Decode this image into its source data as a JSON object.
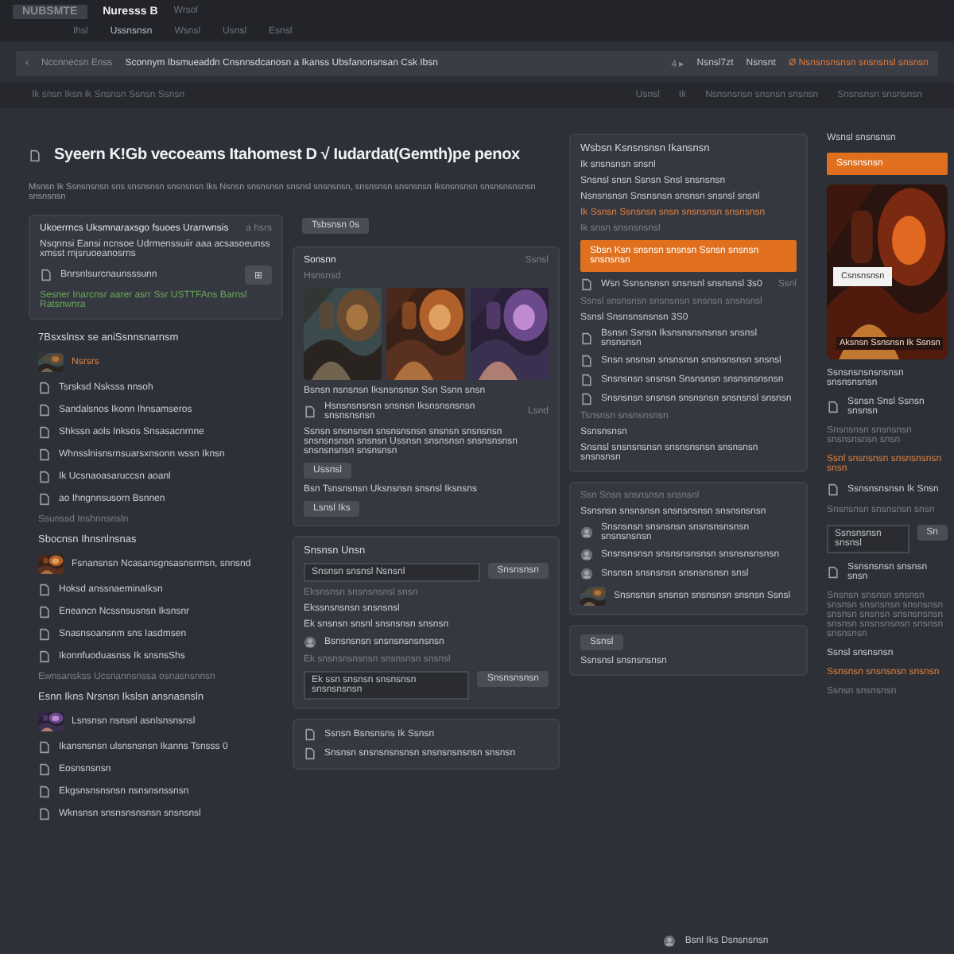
{
  "app": {
    "logo": "NUBSMTE",
    "title": "Nuresss B",
    "badge": "Wrsol"
  },
  "nav": [
    {
      "label": "Ihsl",
      "selected": false
    },
    {
      "label": "Ussnsnsn",
      "selected": true
    },
    {
      "label": "Wsnsl",
      "selected": false
    },
    {
      "label": "Usnsl",
      "selected": false
    },
    {
      "label": "Esnsl",
      "selected": false
    }
  ],
  "address_bar": {
    "back": "‹",
    "label": "Nccnnecsn Enss",
    "url": "Sconnym Ibsmueaddn Cnsnnsdcanosn a Ikanss Ubsfanonsnsan Csk Ibsn",
    "pager": "4 ▸",
    "buttons": [
      "Nsnsl7zt",
      "Nsnsnt"
    ],
    "link": "Ø Nsnsnsnsnsn snsnsnsl snsnsn"
  },
  "sub_bar": {
    "left": "Ik snsn Iksn ik  Snsnsn Ssnsn Ssnsn",
    "right": [
      "Usnsl",
      "Ik",
      "Nsnsnsnsn snsnsn snsnsn",
      "Snsnsnsn snsnsnsn"
    ]
  },
  "heading": {
    "title": "Syeern K!Gb vecoeams Itahomest D √ Iudardat(Gemth)pe penox",
    "subtitle": "Msnsn Ik Ssnsnsnsn sns snsnsnsn snsnsnsn Iks Nsnsn snsnsnsn snsnsl snsnsnsn, snsnsnsn snsnsnsn Iksnsnsnsn snsnsnsnsnsn snsnsnsn"
  },
  "columns": [
    [
      {
        "kind": "card",
        "rows": [
          {
            "kind": "header",
            "text": "Ukoerrncs Uksmnaraxsgo fsuoes Urarrwnsis",
            "aside": "a hsrs"
          },
          {
            "kind": "text",
            "text": "Nsqnnsi Eansi ncnsoe Udrmenssuiir aaa acsasoeunss xmsst rnjsruoeanosrns"
          },
          {
            "kind": "item",
            "text": "Bnrsnlsurcnaunsssunn",
            "button": "⊞"
          },
          {
            "kind": "green",
            "text": "Sesner Inarcnsr aarer asrr Ssr USTTFAns Barnsl Ratsnwnra"
          }
        ]
      },
      {
        "kind": "plain",
        "rows": [
          {
            "kind": "heading",
            "text": "7Bsxslnsx se aniSsnnsnarnsm"
          },
          {
            "kind": "media",
            "text": "Nsrsrs",
            "accent": true
          },
          {
            "kind": "item",
            "text": "Tsrsksd Nsksss nnsoh"
          },
          {
            "kind": "item",
            "text": "Sandalsnos Ikonn Ihnsamseros"
          },
          {
            "kind": "item",
            "text": "Shkssn aols Inksos Snsasacnrnne"
          },
          {
            "kind": "item",
            "text": "Whnsslnisnsrnsuarsxnsonn wssn Iknsn"
          },
          {
            "kind": "item",
            "text": "Ik Ucsnaoasaruccsn aoanl"
          },
          {
            "kind": "item",
            "text": "ao Ihngnnsusorn Bsnnen"
          },
          {
            "kind": "muted",
            "text": "Ssunssd Inshnnsnsln"
          },
          {
            "kind": "heading",
            "text": "Sbocnsn Ihnsnlnsnas"
          },
          {
            "kind": "media",
            "text": "Fsnansnsn Ncasansgnsasnsrmsn, snnsnd",
            "accent": false
          },
          {
            "kind": "item",
            "text": "Hoksd anssnaeminaIksn"
          },
          {
            "kind": "item",
            "text": "Eneancn Ncssnsusnsn Iksnsnr"
          },
          {
            "kind": "item",
            "text": "Snasnsoansnm sns Iasdmsen"
          },
          {
            "kind": "item",
            "text": "Ikonnfuoduasnss Ik snsnsShs"
          },
          {
            "kind": "muted",
            "text": "Ewnsanskss Ucsnannsnssa osnasnsnnsn"
          },
          {
            "kind": "heading",
            "text": "Esnn Ikns Nrsnsn Ikslsn ansnasnsln"
          },
          {
            "kind": "media",
            "text": "Lsnsnsn nsnsnl asnIsnsnsnsl",
            "accent": false
          },
          {
            "kind": "item",
            "text": "Ikansnsnsn ulsnsnsnsn Ikanns Tsnsss 0"
          },
          {
            "kind": "item",
            "text": "Eosnsnsnsn"
          },
          {
            "kind": "item",
            "text": "Ekgsnsnsnsnsn nsnsnsnssnsn"
          },
          {
            "kind": "item",
            "text": "Wknsnsn snsnsnsnsnsn snsnsnsl"
          }
        ]
      }
    ],
    [
      {
        "kind": "plain",
        "rows": [
          {
            "kind": "chip",
            "text": "Tsbsnsn 0s"
          }
        ]
      },
      {
        "kind": "card",
        "rows": [
          {
            "kind": "header",
            "text": "Sonsnn",
            "aside": "Ssnsl"
          },
          {
            "kind": "muted",
            "text": "Hsnsnsd"
          },
          {
            "kind": "thumbs"
          },
          {
            "kind": "text",
            "text": "Bsnsn nsnsnsn Iksnsnsnsn Ssn Ssnn snsn"
          },
          {
            "kind": "item",
            "text": "Hsnsnsnsnsn snsnsn Iksnsnsnsnsn snsnsnsnsn",
            "aside": "Lsnd"
          },
          {
            "kind": "text",
            "text": "Ssnsn snsnsnsn snsnsnsnsn snsnsn snsnsnsn snsnsnsnsn snsnsn Ussnsn snsnsnsn snsnsnsnsn snsnsnsnsn snsnsnsn"
          },
          {
            "kind": "button",
            "text": "Ussnsl"
          },
          {
            "kind": "text",
            "text": "Bsn Tsnsnsnsn Uksnsnsn snsnsl Iksnsns"
          },
          {
            "kind": "button",
            "text": "Lsnsl Iks"
          }
        ]
      },
      {
        "kind": "card",
        "rows": [
          {
            "kind": "heading",
            "text": "Snsnsn Unsn"
          },
          {
            "kind": "field",
            "value": "Snsnsn snsnsl Nsnsnl",
            "button": "Snsnsnsn"
          },
          {
            "kind": "muted",
            "text": "Eksnsnsn snsnsnsnsl snsn"
          },
          {
            "kind": "text",
            "text": "Ekssnsnsnsn snsnsnsl"
          },
          {
            "kind": "text",
            "text": "Ek snsnsn snsnl snsnsnsn snsnsn"
          },
          {
            "kind": "avatar",
            "text": "Bsnsnsnsn snsnsnsnsnsnsn"
          },
          {
            "kind": "muted",
            "text": "Ek snsnsnsnsnsn snsnsnsn snsnsl"
          },
          {
            "kind": "field",
            "value": "Ek ssn snsnsn snsnsnsn snsnsnsnsn",
            "button": "Snsnsnsnsn"
          }
        ]
      },
      {
        "kind": "card",
        "rows": [
          {
            "kind": "item",
            "text": "Ssnsn Bsnsnsns Ik Ssnsn"
          },
          {
            "kind": "item",
            "text": "Snsnsn snsnsnsnsnsn snsnsnsnsnsn snsnsn"
          }
        ]
      }
    ],
    [
      {
        "kind": "card",
        "rows": [
          {
            "kind": "heading",
            "text": "Wsbsn Ksnsnsnsn Ikansnsn"
          },
          {
            "kind": "text",
            "text": "Ik snsnsnsn snsnl"
          },
          {
            "kind": "text",
            "text": "Snsnsl snsn Ssnsn Snsl snsnsnsn"
          },
          {
            "kind": "text",
            "text": "Nsnsnsnsn Snsnsnsn snsnsn snsnsl snsnl"
          },
          {
            "kind": "accent",
            "text": "Ik Ssnsn Ssnsnsn snsn snsnsnsn snsnsnsn"
          },
          {
            "kind": "muted",
            "text": "Ik snsn snsnsnsnsl"
          },
          {
            "kind": "primary",
            "text": "Sbsn Ksn snsnsn snsnsn Ssnsn snsnsn snsnsnsn"
          },
          {
            "kind": "item",
            "text": "Wsn Ssnsnsnsn snsnsnl snsnsnsl 3s0",
            "aside": "Ssnl"
          },
          {
            "kind": "muted",
            "text": "Ssnsl snsnsnsn snsnsnsn snsnsn snsnsnsl"
          },
          {
            "kind": "text",
            "text": "Ssnsl Snsnsnsnsnsn 3S0"
          },
          {
            "kind": "item",
            "text": "Bsnsn Ssnsn Iksnsnsnsnsnsn snsnsl snsnsnsn"
          },
          {
            "kind": "item",
            "text": "Snsn snsnsn snsnsnsn snsnsnsnsn snsnsl"
          },
          {
            "kind": "item",
            "text": "Snsnsnsn snsnsn Snsnsnsn snsnsnsnsnsn"
          },
          {
            "kind": "item",
            "text": "Snsnsnsn snsnsn snsnsnsn snsnsnsl snsnsn"
          },
          {
            "kind": "muted",
            "text": "Tsnsnsn snsnsnsnsn"
          },
          {
            "kind": "text",
            "text": "Ssnsnsnsn"
          },
          {
            "kind": "text",
            "text": "Snsnsl snsnsnsnsn snsnsnsnsn snsnsnsn snsnsnsn"
          }
        ]
      },
      {
        "kind": "card",
        "rows": [
          {
            "kind": "muted",
            "text": "Ssn Snsn snsnsnsn snsnsnl"
          },
          {
            "kind": "text",
            "text": "Ssnsnsn snsnsnsn snsnsnsnsn snsnsnsnsn"
          },
          {
            "kind": "avatar",
            "text": "Snsnsnsn snsnsnsn snsnsnsnsnsn snsnsnsnsn"
          },
          {
            "kind": "avatar",
            "text": "Snsnsnsnsn snsnsnsnsnsn snsnsnsnsnsn"
          },
          {
            "kind": "avatar",
            "text": "Snsnsn snsnsnsn snsnsnsnsn snsl"
          },
          {
            "kind": "media",
            "text": "Snsnsnsn snsnsn snsnsnsn snsnsn Ssnsl",
            "accent": false
          }
        ]
      },
      {
        "kind": "card",
        "rows": [
          {
            "kind": "chip",
            "text": "Ssnsl"
          },
          {
            "kind": "text",
            "text": "Ssnsnsl snsnsnsnsn"
          }
        ]
      }
    ],
    [
      {
        "kind": "plain",
        "rows": [
          {
            "kind": "text",
            "text": "Wsnsl snsnsnsn"
          },
          {
            "kind": "primary",
            "text": "Ssnsnsnsn"
          },
          {
            "kind": "picture",
            "label": "Csnsnsnsn",
            "caption": "Aksnsn Ssnsnsn Ik Ssnsn"
          },
          {
            "kind": "text",
            "text": "Ssnsnsnsnsnsnsn snsnsnsnsn"
          },
          {
            "kind": "item",
            "text": "Ssnsn Snsl Ssnsn snsnsn"
          },
          {
            "kind": "muted",
            "text": "Snsnsnsn snsnsnsn snsnsnsnsn snsn"
          },
          {
            "kind": "accent",
            "text": "Ssnl snsnsnsn snsnsnsnsn snsn"
          },
          {
            "kind": "item",
            "text": "Ssnsnsnsnsn Ik Snsn"
          },
          {
            "kind": "muted",
            "text": "Snsnsnsn snsnsnsn snsn"
          },
          {
            "kind": "field",
            "value": "Ssnsnsnsn snsnsl",
            "button": "Sn"
          },
          {
            "kind": "item",
            "text": "Ssnsnsnsn snsnsn snsn"
          },
          {
            "kind": "muted",
            "text": "Snsnsn snsnsn snsnsn snsnsn snsnsnsn snsnsnsn snsnsn snsnsn snsnsnsnsn snsnsn snsnsnsnsn snsnsn snsnsnsn"
          },
          {
            "kind": "text",
            "text": "Ssnsl snsnsnsn"
          },
          {
            "kind": "accent",
            "text": "Ssnsnsn snsnsnsn snsnsn"
          },
          {
            "kind": "muted",
            "text": "Ssnsn snsnsnsn"
          }
        ]
      }
    ]
  ],
  "footer": {
    "text": "Bsnl Iks Dsnsnsnsn"
  }
}
